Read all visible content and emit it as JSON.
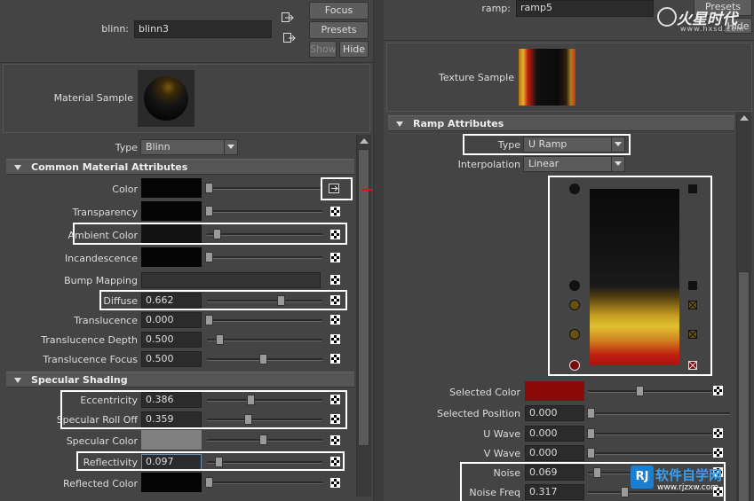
{
  "left": {
    "header": {
      "name_label": "blinn:",
      "name_value": "blinn3",
      "focus_label": "Focus",
      "presets_label": "Presets",
      "show_label": "Show",
      "hide_label": "Hide"
    },
    "material_sample_label": "Material Sample",
    "type_label": "Type",
    "type_value": "Blinn",
    "sections": {
      "common": "Common Material Attributes",
      "specular": "Specular Shading"
    },
    "attrs": {
      "color": "Color",
      "transparency": "Transparency",
      "ambient_color": "Ambient Color",
      "incandescence": "Incandescence",
      "bump_mapping": "Bump Mapping",
      "diffuse": "Diffuse",
      "diffuse_value": "0.662",
      "translucence": "Translucence",
      "translucence_value": "0.000",
      "translucence_depth": "Translucence Depth",
      "translucence_depth_value": "0.500",
      "translucence_focus": "Translucence Focus",
      "translucence_focus_value": "0.500",
      "eccentricity": "Eccentricity",
      "eccentricity_value": "0.386",
      "specular_roll_off": "Specular Roll Off",
      "specular_roll_off_value": "0.359",
      "specular_color": "Specular Color",
      "reflectivity": "Reflectivity",
      "reflectivity_value": "0.097",
      "reflected_color": "Reflected Color"
    }
  },
  "right": {
    "header": {
      "name_label": "ramp:",
      "name_value": "ramp5",
      "presets_label": "Presets",
      "hide_label": "Hide"
    },
    "texture_sample_label": "Texture Sample",
    "section": "Ramp Attributes",
    "type_label": "Type",
    "type_value": "U Ramp",
    "interpolation_label": "Interpolation",
    "interpolation_value": "Linear",
    "attrs": {
      "selected_color": "Selected Color",
      "selected_position": "Selected Position",
      "selected_position_value": "0.000",
      "u_wave": "U Wave",
      "u_wave_value": "0.000",
      "v_wave": "V Wave",
      "v_wave_value": "0.000",
      "noise": "Noise",
      "noise_value": "0.069",
      "noise_freq": "Noise Freq",
      "noise_freq_value": "0.317"
    }
  },
  "watermarks": {
    "top_right": "火星时代",
    "top_right_url": "www.hxsd.com",
    "bottom_right": "软件自学网",
    "bottom_right_url": "www.rjzxw.com",
    "bottom_logo": "RJ"
  },
  "colors": {
    "panel_bg": "#444444",
    "field_bg": "#2b2b2b",
    "highlight": "#ffffff",
    "arrow": "#e01010",
    "selected_color": "#8a0a0a",
    "specular_color": "#808080"
  }
}
